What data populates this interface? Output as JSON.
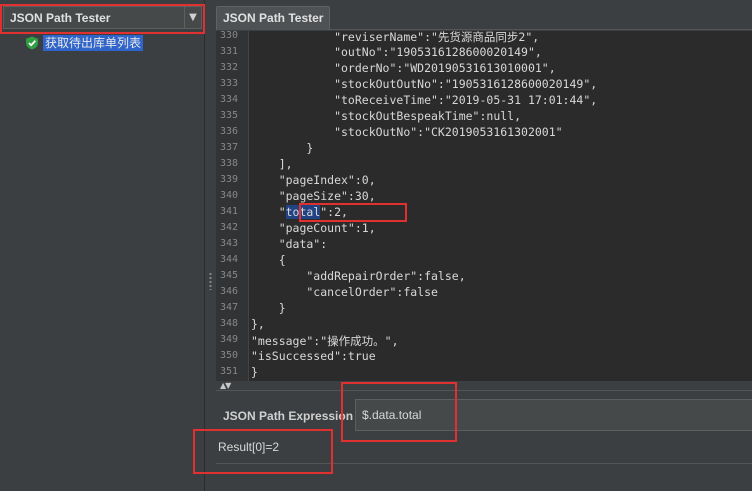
{
  "left": {
    "view_selector": "JSON Path Tester",
    "tree_item": "获取待出库单列表"
  },
  "tabs": [
    {
      "label": "JSON Path Tester"
    }
  ],
  "code": {
    "lines": [
      {
        "num": "330",
        "text": "            \"reviserName\":\"先货源商品同步2\","
      },
      {
        "num": "331",
        "text": "            \"outNo\":\"1905316128600020149\","
      },
      {
        "num": "332",
        "text": "            \"orderNo\":\"WD20190531613010001\","
      },
      {
        "num": "333",
        "text": "            \"stockOutOutNo\":\"1905316128600020149\","
      },
      {
        "num": "334",
        "text": "            \"toReceiveTime\":\"2019-05-31 17:01:44\","
      },
      {
        "num": "335",
        "text": "            \"stockOutBespeakTime\":null,"
      },
      {
        "num": "336",
        "text": "            \"stockOutNo\":\"CK2019053161302001\""
      },
      {
        "num": "337",
        "text": "        }"
      },
      {
        "num": "338",
        "text": "    ],"
      },
      {
        "num": "339",
        "text": "    \"pageIndex\":0,"
      },
      {
        "num": "340",
        "text": "    \"pageSize\":30,"
      },
      {
        "num": "341",
        "pre": "    \"",
        "hl": "total",
        "post": "\":2,"
      },
      {
        "num": "342",
        "text": "    \"pageCount\":1,"
      },
      {
        "num": "343",
        "text": "    \"data\":"
      },
      {
        "num": "344",
        "text": "    {"
      },
      {
        "num": "345",
        "text": "        \"addRepairOrder\":false,"
      },
      {
        "num": "346",
        "text": "        \"cancelOrder\":false"
      },
      {
        "num": "347",
        "text": "    }"
      },
      {
        "num": "348",
        "text": "},"
      },
      {
        "num": "349",
        "text": "\"message\":\"操作成功。\","
      },
      {
        "num": "350",
        "text": "\"isSuccessed\":true"
      },
      {
        "num": "351",
        "text": "}"
      }
    ],
    "indents": [
      0,
      1,
      1,
      1,
      1,
      1,
      1,
      1,
      1,
      1,
      1,
      1,
      1,
      1,
      1,
      1,
      1,
      1,
      2,
      2,
      2,
      3
    ]
  },
  "expression": {
    "label": "JSON Path Expression",
    "value": "$.data.total"
  },
  "result": "Result[0]=2",
  "colors": {
    "annotation": "#e03030",
    "selection": "#2f65ca",
    "shield": "#2ea043"
  }
}
